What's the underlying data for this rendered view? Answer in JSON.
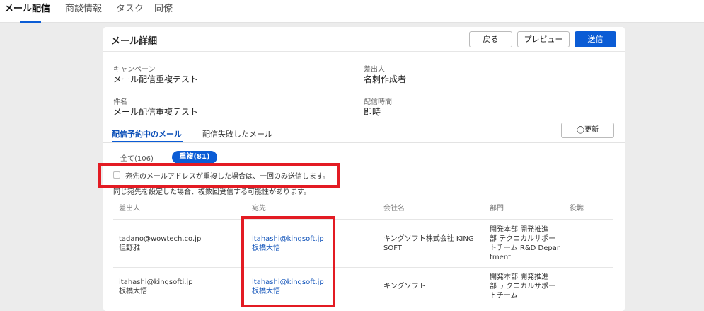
{
  "topnav": {
    "tabs": [
      {
        "label": "メール配信"
      },
      {
        "label": "商談情報"
      },
      {
        "label": "タスク"
      },
      {
        "label": "同僚"
      }
    ]
  },
  "detail": {
    "title": "メール詳細",
    "buttons": {
      "back": "戻る",
      "preview": "プレビュー",
      "send": "送信"
    },
    "fields": {
      "campaign_label": "キャンペーン",
      "campaign_value": "メール配信重複テスト",
      "sender_label": "差出人",
      "sender_value": "名刺作成者",
      "subject_label": "件名",
      "subject_value": "メール配信重複テスト",
      "send_time_label": "配信時間",
      "send_time_value": "即時"
    },
    "subtabs": {
      "scheduled": "配信予約中のメール",
      "failed": "配信失敗したメール"
    },
    "refresh_label": "◯更新",
    "filters": {
      "all": "全て(106)",
      "duplicates": "重複(81)"
    },
    "dedupe_label": "宛先のメールアドレスが重複した場合は、一回のみ送信します。",
    "warning": "同じ宛先を設定した場合、複数回受信する可能性があります。",
    "table": {
      "headers": {
        "sender": "差出人",
        "recipient": "宛先",
        "company": "会社名",
        "department": "部門",
        "title": "役職"
      },
      "rows": [
        {
          "sender_email": "tadano@wowtech.co.jp",
          "sender_name": "但野雅",
          "recipient_email": "itahashi@kingsoft.jp",
          "recipient_name": "板橋大悟",
          "company_1": "キングソフト株式会社 KING",
          "company_2": "SOFT",
          "dept_1": "開発本部 開発推進",
          "dept_2": "部 テクニカルサポー",
          "dept_3": "トチーム R&D Depar",
          "dept_4": "tment"
        },
        {
          "sender_email": "itahashi@kingsofti.jp",
          "sender_name": "板橋大悟",
          "recipient_email": "itahashi@kingsoft.jp",
          "recipient_name": "板橋大悟",
          "company_1": "キングソフト",
          "dept_1": "開発本部 開発推進",
          "dept_2": "部 テクニカルサポー",
          "dept_3": "トチーム"
        }
      ]
    }
  }
}
